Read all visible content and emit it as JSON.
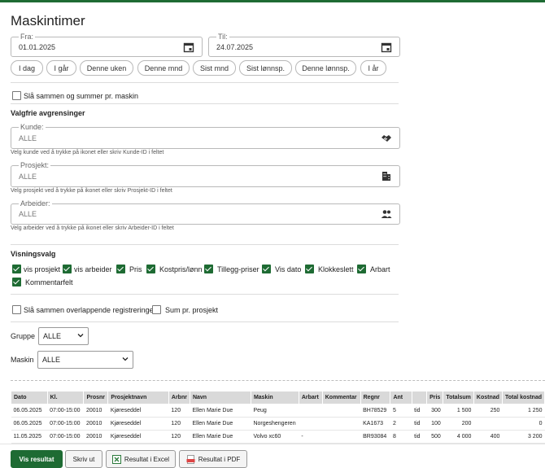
{
  "page": {
    "title": "Maskintimer"
  },
  "dates": {
    "from": {
      "label": "Fra:",
      "value": "01.01.2025"
    },
    "to": {
      "label": "Til:",
      "value": "24.07.2025"
    }
  },
  "quick_ranges": [
    "I dag",
    "I går",
    "Denne uken",
    "Denne mnd",
    "Sist mnd",
    "Sist lønnsp.",
    "Denne lønnsp.",
    "I år"
  ],
  "merge_machine": {
    "label": "Slå sammen og summer pr. maskin",
    "checked": false
  },
  "filters": {
    "heading": "Valgfrie avgrensinger",
    "customer": {
      "label": "Kunde:",
      "value": "ALLE",
      "help": "Velg kunde ved å trykke på ikonet eller skriv Kunde-ID i feltet",
      "icon": "handshake-icon"
    },
    "project": {
      "label": "Prosjekt:",
      "value": "ALLE",
      "help": "Velg prosjekt ved å trykke på ikonet eller skriv Prosjekt-ID i feltet",
      "icon": "building-icon"
    },
    "worker": {
      "label": "Arbeider:",
      "value": "ALLE",
      "help": "Velg arbeider ved å trykke på ikonet eller skriv Arbeider-ID i feltet",
      "icon": "people-icon"
    }
  },
  "view": {
    "heading": "Visningsvalg",
    "options": [
      {
        "label": "vis prosjekt",
        "checked": true
      },
      {
        "label": "vis arbeider",
        "checked": true
      },
      {
        "label": "Pris",
        "checked": true
      },
      {
        "label": "Kostpris/lønn",
        "checked": true
      },
      {
        "label": "Tillegg-priser",
        "checked": true
      },
      {
        "label": "Vis dato",
        "checked": true
      },
      {
        "label": "Klokkeslett",
        "checked": true
      },
      {
        "label": "Arbart",
        "checked": true
      },
      {
        "label": "Kommentarfelt",
        "checked": true
      }
    ]
  },
  "merge_overlap": {
    "label": "Slå sammen overlappende registreringer",
    "checked": false
  },
  "sum_project": {
    "label": "Sum pr. prosjekt",
    "checked": false
  },
  "group": {
    "label": "Gruppe",
    "value": "ALLE"
  },
  "machine": {
    "label": "Maskin",
    "value": "ALLE"
  },
  "table": {
    "headers": [
      "Dato",
      "Kl.",
      "Prosnr",
      "Prosjektnavn",
      "Arbnr",
      "Navn",
      "Maskin",
      "Arbart",
      "Kommentar",
      "Regnr",
      "Ant",
      "",
      "Pris",
      "Totalsum",
      "Kostnad",
      "Total kostnad"
    ],
    "rows": [
      [
        "06.05.2025",
        "07:00-15:00",
        "20010",
        "Kjøreseddel",
        "120",
        "Ellen Marie Due",
        "Peug",
        "",
        "",
        "BH78529",
        "5",
        "tid",
        "300",
        "1 500",
        "250",
        "1 250"
      ],
      [
        "06.05.2025",
        "07:00-15:00",
        "20010",
        "Kjøreseddel",
        "120",
        "Ellen Marie Due",
        "Norgeshengeren",
        "",
        "",
        "KA1673",
        "2",
        "tid",
        "100",
        "200",
        "",
        "0"
      ],
      [
        "11.05.2025",
        "07:00-15:00",
        "20010",
        "Kjøreseddel",
        "120",
        "Ellen Marie Due",
        "Volvo xc60",
        "-",
        "",
        "BR93084",
        "8",
        "tid",
        "500",
        "4 000",
        "400",
        "3 200"
      ]
    ]
  },
  "footer": {
    "show": "Vis resultat",
    "print": "Skriv ut",
    "excel": "Resultat i Excel",
    "pdf": "Resultat i PDF"
  },
  "colors": {
    "accent": "#1e6b33",
    "header_bg": "#d9d9d9"
  }
}
